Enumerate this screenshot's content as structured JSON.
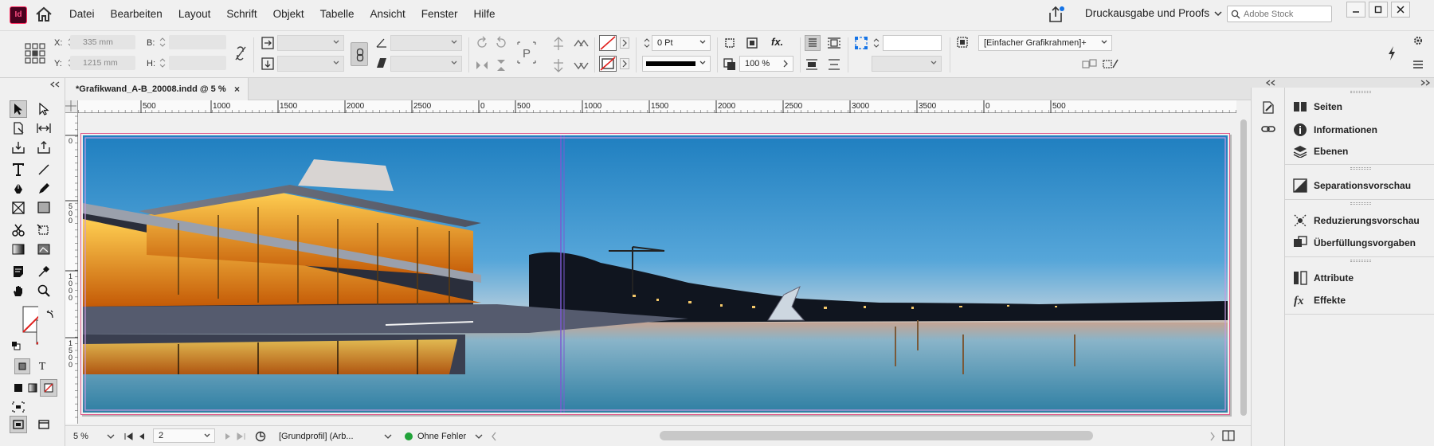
{
  "app": {
    "logo_text": "Id",
    "brand_color": "#49021f",
    "accent": "#ff3366"
  },
  "menubar": {
    "items": [
      "Datei",
      "Bearbeiten",
      "Layout",
      "Schrift",
      "Objekt",
      "Tabelle",
      "Ansicht",
      "Fenster",
      "Hilfe"
    ],
    "workspace": "Druckausgabe und Proofs",
    "search_placeholder": "Adobe Stock"
  },
  "controlbar": {
    "x_label": "X:",
    "x_value": "335 mm",
    "y_label": "Y:",
    "y_value": "1215 mm",
    "b_label": "B:",
    "h_label": "H:",
    "stroke_weight": "0 Pt",
    "zoom_percent": "100 %",
    "object_style": "[Einfacher Grafikrahmen]+",
    "fx_label": "fx."
  },
  "document": {
    "tab_title": "*Grafikwand_A-B_20008.indd @ 5 %",
    "close_symbol": "×"
  },
  "ruler": {
    "top_labels": [
      "0",
      "500",
      "1000",
      "1500",
      "2000",
      "2500",
      "0",
      "500",
      "1000",
      "1500",
      "2000",
      "2500",
      "3000",
      "3500",
      "0",
      "500"
    ],
    "left_labels": [
      "0",
      "500",
      "1000",
      "1500"
    ]
  },
  "statusbar": {
    "zoom": "5 %",
    "page": "2",
    "profile": "[Grundprofil] (Arb...",
    "preflight": "Ohne Fehler",
    "preflight_color": "#22a33a"
  },
  "panels": {
    "items": [
      {
        "label": "Seiten",
        "icon": "pages-icon"
      },
      {
        "label": "Informationen",
        "icon": "info-icon"
      },
      {
        "label": "Ebenen",
        "icon": "layers-icon"
      },
      {
        "label": "Separationsvorschau",
        "icon": "separations-icon"
      },
      {
        "label": "Reduzierungsvorschau",
        "icon": "flattener-icon"
      },
      {
        "label": "Überfüllungsvorgaben",
        "icon": "trap-presets-icon"
      },
      {
        "label": "Attribute",
        "icon": "attributes-icon"
      },
      {
        "label": "Effekte",
        "icon": "effects-icon"
      }
    ]
  }
}
